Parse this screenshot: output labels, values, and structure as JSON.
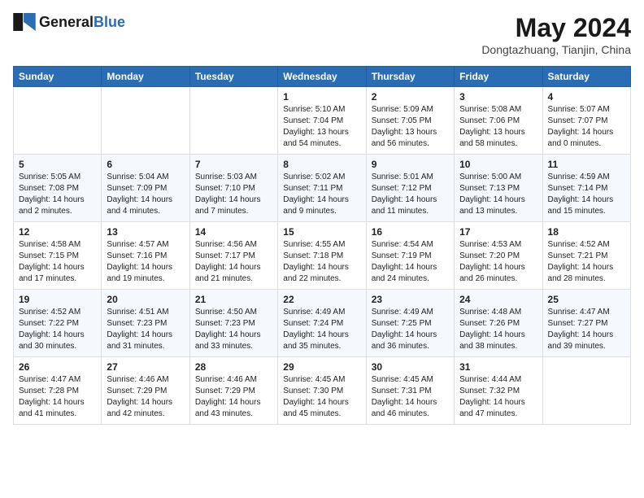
{
  "header": {
    "logo": {
      "general": "General",
      "blue": "Blue"
    },
    "title": "May 2024",
    "location": "Dongtazhuang, Tianjin, China"
  },
  "weekdays": [
    "Sunday",
    "Monday",
    "Tuesday",
    "Wednesday",
    "Thursday",
    "Friday",
    "Saturday"
  ],
  "weeks": [
    [
      null,
      null,
      null,
      {
        "day": 1,
        "sunrise": "5:10 AM",
        "sunset": "7:04 PM",
        "daylight": "13 hours and 54 minutes."
      },
      {
        "day": 2,
        "sunrise": "5:09 AM",
        "sunset": "7:05 PM",
        "daylight": "13 hours and 56 minutes."
      },
      {
        "day": 3,
        "sunrise": "5:08 AM",
        "sunset": "7:06 PM",
        "daylight": "13 hours and 58 minutes."
      },
      {
        "day": 4,
        "sunrise": "5:07 AM",
        "sunset": "7:07 PM",
        "daylight": "14 hours and 0 minutes."
      }
    ],
    [
      {
        "day": 5,
        "sunrise": "5:05 AM",
        "sunset": "7:08 PM",
        "daylight": "14 hours and 2 minutes."
      },
      {
        "day": 6,
        "sunrise": "5:04 AM",
        "sunset": "7:09 PM",
        "daylight": "14 hours and 4 minutes."
      },
      {
        "day": 7,
        "sunrise": "5:03 AM",
        "sunset": "7:10 PM",
        "daylight": "14 hours and 7 minutes."
      },
      {
        "day": 8,
        "sunrise": "5:02 AM",
        "sunset": "7:11 PM",
        "daylight": "14 hours and 9 minutes."
      },
      {
        "day": 9,
        "sunrise": "5:01 AM",
        "sunset": "7:12 PM",
        "daylight": "14 hours and 11 minutes."
      },
      {
        "day": 10,
        "sunrise": "5:00 AM",
        "sunset": "7:13 PM",
        "daylight": "14 hours and 13 minutes."
      },
      {
        "day": 11,
        "sunrise": "4:59 AM",
        "sunset": "7:14 PM",
        "daylight": "14 hours and 15 minutes."
      }
    ],
    [
      {
        "day": 12,
        "sunrise": "4:58 AM",
        "sunset": "7:15 PM",
        "daylight": "14 hours and 17 minutes."
      },
      {
        "day": 13,
        "sunrise": "4:57 AM",
        "sunset": "7:16 PM",
        "daylight": "14 hours and 19 minutes."
      },
      {
        "day": 14,
        "sunrise": "4:56 AM",
        "sunset": "7:17 PM",
        "daylight": "14 hours and 21 minutes."
      },
      {
        "day": 15,
        "sunrise": "4:55 AM",
        "sunset": "7:18 PM",
        "daylight": "14 hours and 22 minutes."
      },
      {
        "day": 16,
        "sunrise": "4:54 AM",
        "sunset": "7:19 PM",
        "daylight": "14 hours and 24 minutes."
      },
      {
        "day": 17,
        "sunrise": "4:53 AM",
        "sunset": "7:20 PM",
        "daylight": "14 hours and 26 minutes."
      },
      {
        "day": 18,
        "sunrise": "4:52 AM",
        "sunset": "7:21 PM",
        "daylight": "14 hours and 28 minutes."
      }
    ],
    [
      {
        "day": 19,
        "sunrise": "4:52 AM",
        "sunset": "7:22 PM",
        "daylight": "14 hours and 30 minutes."
      },
      {
        "day": 20,
        "sunrise": "4:51 AM",
        "sunset": "7:23 PM",
        "daylight": "14 hours and 31 minutes."
      },
      {
        "day": 21,
        "sunrise": "4:50 AM",
        "sunset": "7:23 PM",
        "daylight": "14 hours and 33 minutes."
      },
      {
        "day": 22,
        "sunrise": "4:49 AM",
        "sunset": "7:24 PM",
        "daylight": "14 hours and 35 minutes."
      },
      {
        "day": 23,
        "sunrise": "4:49 AM",
        "sunset": "7:25 PM",
        "daylight": "14 hours and 36 minutes."
      },
      {
        "day": 24,
        "sunrise": "4:48 AM",
        "sunset": "7:26 PM",
        "daylight": "14 hours and 38 minutes."
      },
      {
        "day": 25,
        "sunrise": "4:47 AM",
        "sunset": "7:27 PM",
        "daylight": "14 hours and 39 minutes."
      }
    ],
    [
      {
        "day": 26,
        "sunrise": "4:47 AM",
        "sunset": "7:28 PM",
        "daylight": "14 hours and 41 minutes."
      },
      {
        "day": 27,
        "sunrise": "4:46 AM",
        "sunset": "7:29 PM",
        "daylight": "14 hours and 42 minutes."
      },
      {
        "day": 28,
        "sunrise": "4:46 AM",
        "sunset": "7:29 PM",
        "daylight": "14 hours and 43 minutes."
      },
      {
        "day": 29,
        "sunrise": "4:45 AM",
        "sunset": "7:30 PM",
        "daylight": "14 hours and 45 minutes."
      },
      {
        "day": 30,
        "sunrise": "4:45 AM",
        "sunset": "7:31 PM",
        "daylight": "14 hours and 46 minutes."
      },
      {
        "day": 31,
        "sunrise": "4:44 AM",
        "sunset": "7:32 PM",
        "daylight": "14 hours and 47 minutes."
      },
      null
    ]
  ]
}
